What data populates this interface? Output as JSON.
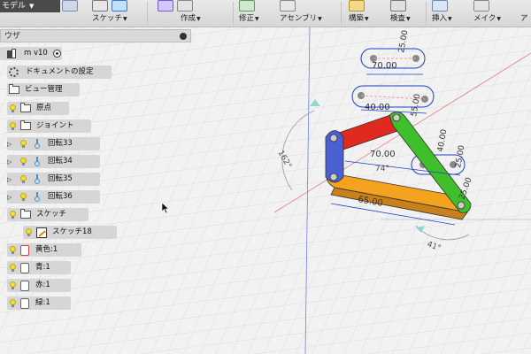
{
  "toolbar": {
    "workspace": "モデル",
    "groups": [
      {
        "id": "sketch",
        "label": "スケッチ"
      },
      {
        "id": "create",
        "label": "作成"
      },
      {
        "id": "modify",
        "label": "修正"
      },
      {
        "id": "assemble",
        "label": "アセンブリ"
      },
      {
        "id": "construct",
        "label": "構築"
      },
      {
        "id": "inspect",
        "label": "検査"
      },
      {
        "id": "insert",
        "label": "挿入"
      },
      {
        "id": "make",
        "label": "メイク"
      },
      {
        "id": "addins",
        "label": "ア"
      }
    ]
  },
  "browser": {
    "header": "ウザ",
    "component": "m v10",
    "items": {
      "doc_settings": "ドキュメントの設定",
      "named_views": "ビュー管理",
      "origin": "原点",
      "joints": "ジョイント",
      "rev33": "回転33",
      "rev34": "回転34",
      "rev35": "回転35",
      "rev36": "回転36",
      "sketches": "スケッチ",
      "sketch18": "スケッチ18",
      "body_yellow": "黄色:1",
      "body_blue": "青:1",
      "body_red": "赤:1",
      "body_green": "緑:1"
    }
  },
  "viewport": {
    "dims": {
      "d1": "70.00",
      "d2": "40.00",
      "d3": "70.00",
      "d4": "65.00",
      "d5": "25.00",
      "d6": "55.00",
      "d7": "40.00",
      "d8": "25.00",
      "d9": "25.00",
      "d10": "74°",
      "angle_left": "162°",
      "angle_bottom": "41°"
    },
    "colors": {
      "yellow_body": "#f4a31f",
      "blue_body": "#4a5fd1",
      "red_body": "#e02a20",
      "green_body": "#3fbf2a",
      "dimension": "#1f3fc8",
      "grid": "#cfcfcf",
      "x_axis": "#e06060",
      "y_axis": "#6070e0"
    }
  }
}
